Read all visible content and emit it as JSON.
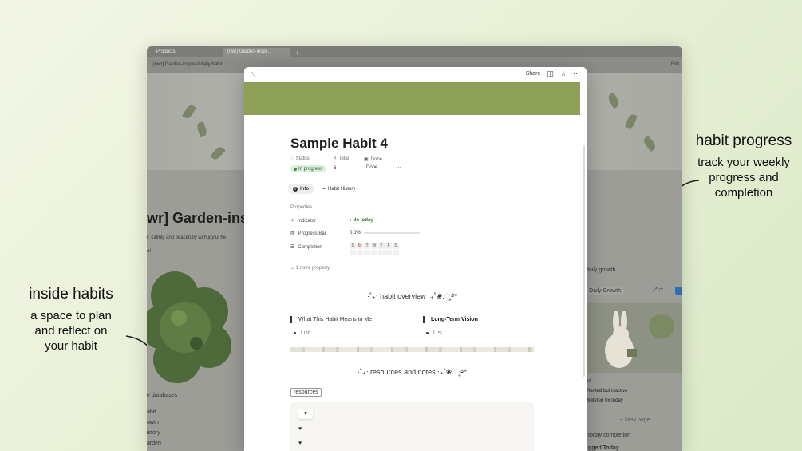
{
  "annotations": {
    "left": {
      "title": "inside habits",
      "desc": "a space to plan and reflect on your habit"
    },
    "right": {
      "title": "habit progress",
      "desc": "track your weekly progress and completion"
    }
  },
  "background_window": {
    "tabs": [
      "Products",
      "[nwr] Garden-inspi..."
    ],
    "breadcrumb": "[nwr] Garden-inspired daily habit...",
    "edit_label": "Edit",
    "title": "wr] Garden-ins",
    "subtitle": "r: calmly and peacefully with joyful he",
    "subtitle2": "e!",
    "databases_label": "e databases",
    "list": [
      "abit",
      "owth",
      "istory",
      "arden"
    ],
    "right_label": "daily growth",
    "chip": "Daily Growth",
    "card_lines": [
      "ed",
      "Planted but inactive",
      "Watered 0x today"
    ],
    "new_page": "+ New page",
    "today_completion": "today completion",
    "logged_today": "gged Today"
  },
  "modal": {
    "share_label": "Share",
    "page_title": "Sample Habit 4",
    "props_header": {
      "status_label": "Status",
      "total_label": "Total",
      "done_label": "Done"
    },
    "status_value": "In progress",
    "total_value": "6",
    "done_value": "Done",
    "tabs": [
      {
        "label": "Info"
      },
      {
        "label": "Habit History"
      }
    ],
    "properties_label": "Properties",
    "properties": {
      "indicator_label": "Indicator",
      "indicator_value": "↓ do today",
      "progress_label": "Progress Bar",
      "progress_value": "0.0%",
      "progress_fraction": 0.0,
      "completion_label": "Completion",
      "days": [
        "S",
        "M",
        "T",
        "W",
        "T",
        "F",
        "S"
      ]
    },
    "more_property": "1 more property",
    "habit_overview": "·˚₊‧ habit overview ‧₊˚❀.ೃ࿔*",
    "col1_title": "What This Habit Means to Me",
    "col2_title": "Long-Term Vision",
    "list_placeholder": "List",
    "resources_heading": "·˚₊‧ resources and notes ‧₊˚❀.ೃ࿔*",
    "resources_tag": "resources",
    "heart": "♥"
  }
}
